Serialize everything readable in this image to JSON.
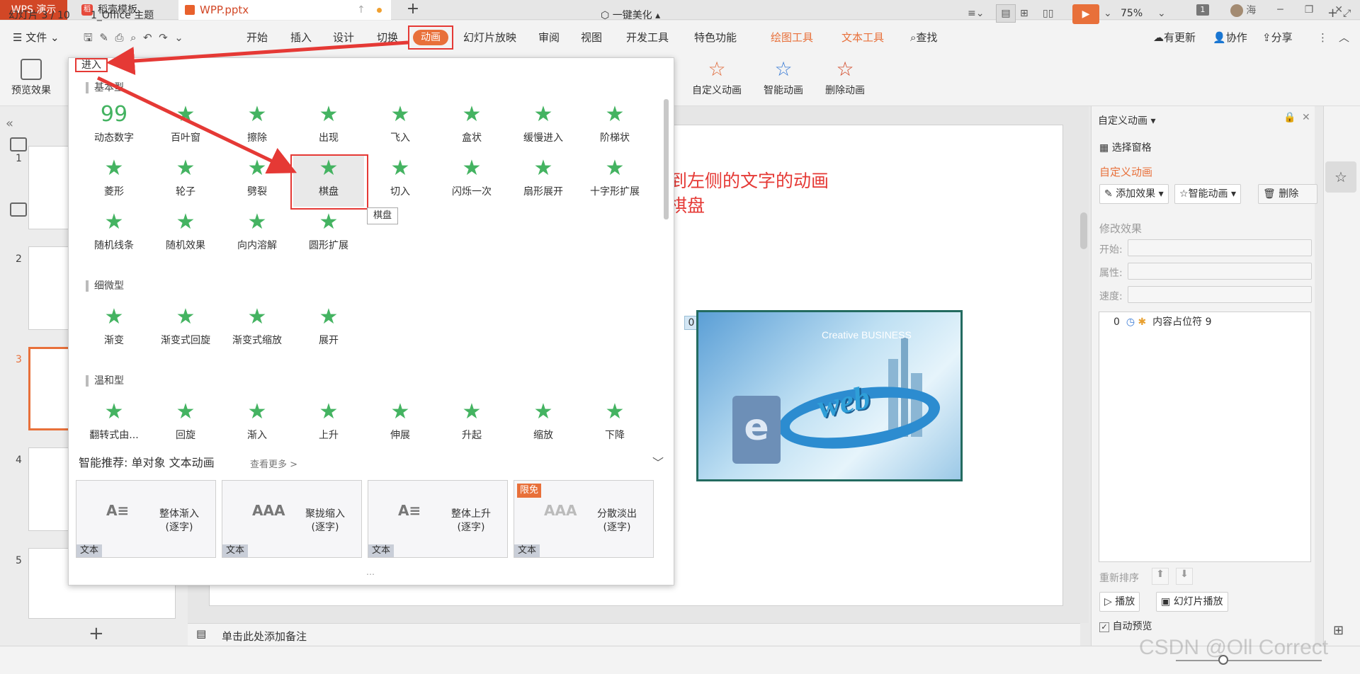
{
  "titlebar": {
    "app_tab": "WPS 演示",
    "template_tab": "稻壳模板",
    "doc_tab": "WPP.pptx",
    "new_tab": "+",
    "badge": "1",
    "user": "海"
  },
  "menu": {
    "file": "文件",
    "items": [
      "开始",
      "插入",
      "设计",
      "切换",
      "动画",
      "幻灯片放映",
      "审阅",
      "视图",
      "开发工具",
      "特色功能",
      "绘图工具",
      "文本工具",
      "查找"
    ],
    "active": "动画",
    "right": [
      "有更新",
      "协作",
      "分享"
    ]
  },
  "ribbon": {
    "preview": "预览效果",
    "custom_anim": "自定义动画",
    "smart_anim": "智能动画",
    "delete_anim": "删除动画"
  },
  "gallery": {
    "enter_label": "进入",
    "sections": [
      {
        "title": "基本型",
        "effects": [
          "动态数字",
          "百叶窗",
          "擦除",
          "出现",
          "飞入",
          "盒状",
          "缓慢进入",
          "阶梯状",
          "菱形",
          "轮子",
          "劈裂",
          "棋盘",
          "切入",
          "闪烁一次",
          "扇形展开",
          "十字形扩展",
          "随机线条",
          "随机效果",
          "向内溶解",
          "圆形扩展"
        ]
      },
      {
        "title": "细微型",
        "effects": [
          "渐变",
          "渐变式回旋",
          "渐变式缩放",
          "展开"
        ]
      },
      {
        "title": "温和型",
        "effects": [
          "翻转式由...",
          "回旋",
          "渐入",
          "上升",
          "伸展",
          "升起",
          "缩放",
          "下降"
        ]
      }
    ],
    "tooltip": "棋盘",
    "smart_title": "智能推荐: 单对象 文本动画",
    "smart_more": "查看更多 >",
    "cards": [
      {
        "title": "整体渐入",
        "sub": "(逐字)",
        "tag": "文本",
        "free": ""
      },
      {
        "title": "聚拢缩入",
        "sub": "(逐字)",
        "tag": "文本",
        "free": ""
      },
      {
        "title": "整体上升",
        "sub": "(逐字)",
        "tag": "文本",
        "free": ""
      },
      {
        "title": "分散淡出",
        "sub": "(逐字)",
        "tag": "文本",
        "free": "限免"
      }
    ]
  },
  "thumbs": {
    "numbers": [
      "1",
      "2",
      "3",
      "4",
      "5"
    ],
    "active": "3"
  },
  "slide": {
    "note_line1": "将刚刚复制到左侧的文字的动画",
    "note_line2": "进入设置为棋盘",
    "image_tag": "0",
    "image_brand": "Creative BUSINESS",
    "image_word": "web",
    "image_letter": "e"
  },
  "notes_placeholder": "单击此处添加备注",
  "right_panel": {
    "header": "自定义动画",
    "select_pane": "选择窗格",
    "section": "自定义动画",
    "add_effect": "添加效果",
    "smart_anim": "智能动画",
    "delete": "删除",
    "modify": "修改效果",
    "start": "开始:",
    "prop": "属性:",
    "speed": "速度:",
    "list_item_num": "0",
    "list_item": "内容占位符 9",
    "reorder": "重新排序",
    "play": "播放",
    "slideshow": "幻灯片播放",
    "autopreview": "自动预览"
  },
  "status": {
    "slide_pos": "幻灯片 3 / 10",
    "theme": "1_Office 主题",
    "beautify": "一键美化",
    "zoom": "75%"
  },
  "watermark": "CSDN @Oll Correct",
  "colors": {
    "accent": "#e8703a",
    "annotation": "#e53935",
    "effect_green": "#44b361"
  }
}
